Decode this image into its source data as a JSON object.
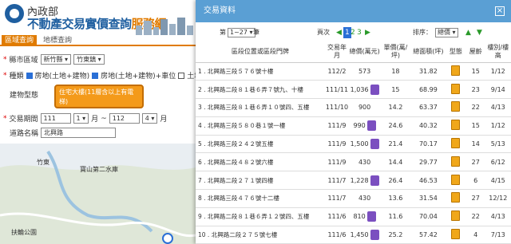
{
  "header": {
    "ministry": "內政部",
    "title_main": "不動產交易實價查詢",
    "title_hl": "服務網"
  },
  "tabs": [
    "區域查詢",
    "地標查詢"
  ],
  "form": {
    "county_label": "縣市區域",
    "county_value": "新竹縣",
    "district_value": "竹東鎮",
    "type_label": "種類",
    "type_options": [
      "房地(土地+建物)",
      "房地(土地+建物)+車位",
      "土地"
    ],
    "building_label": "建物型態",
    "building_value": "住宅大樓(11層含以上有電梯)",
    "period_label": "交易期間",
    "from_year": "111",
    "from_month": "1",
    "to_year": "112",
    "to_month": "4",
    "month_suffix": "月",
    "road_label": "道路名稱",
    "road_value": "北興路",
    "tilde": "~"
  },
  "map": {
    "label_1": "寶山第二水庫",
    "label_2": "扶輪公園",
    "label_3": "竹東"
  },
  "dialog": {
    "title": "交易資料",
    "close": "×",
    "page_prefix": "第",
    "page_sel": "1~27",
    "page_suffix": "筆",
    "page_label": "頁次",
    "pages": [
      "1",
      "2",
      "3"
    ],
    "sort_label": "排序：",
    "sort_value": "總價"
  },
  "columns": [
    "區段位置或區段門牌",
    "交易年月",
    "總價(萬元)",
    "單價(萬/坪)",
    "總面積(坪)",
    "型態",
    "屋齡",
    "樓別/樓高"
  ],
  "rows": [
    {
      "addr": "1 . 北興路三段５７６號十樓",
      "ym": "112/2",
      "total": "573",
      "unit": "18",
      "area": "31.82",
      "age": "15",
      "floor": "1/12",
      "pill": false
    },
    {
      "addr": "2 . 北興路二段８１巷６弄７號九、十樓",
      "ym": "111/11",
      "total": "1,036",
      "unit": "15",
      "area": "68.99",
      "age": "23",
      "floor": "9/14",
      "pill": true
    },
    {
      "addr": "3 . 北興路三段８１巷６弄１０號四、五樓",
      "ym": "111/10",
      "total": "900",
      "unit": "14.2",
      "area": "63.37",
      "age": "22",
      "floor": "4/13",
      "pill": false
    },
    {
      "addr": "4 . 北興路三段５８０巷１號一樓",
      "ym": "111/9",
      "total": "990",
      "unit": "24.6",
      "area": "40.32",
      "age": "15",
      "floor": "1/12",
      "pill": true
    },
    {
      "addr": "5 . 北興路三段２４２號五樓",
      "ym": "111/9",
      "total": "1,500",
      "unit": "21.4",
      "area": "70.17",
      "age": "14",
      "floor": "5/13",
      "pill": true
    },
    {
      "addr": "6 . 北興路二段４８２號六樓",
      "ym": "111/9",
      "total": "430",
      "unit": "14.4",
      "area": "29.77",
      "age": "27",
      "floor": "6/12",
      "pill": false
    },
    {
      "addr": "7 . 北興路二段２７１號四樓",
      "ym": "111/7",
      "total": "1,228",
      "unit": "26.4",
      "area": "46.53",
      "age": "6",
      "floor": "4/15",
      "pill": true
    },
    {
      "addr": "8 . 北興路三段４７６號十二樓",
      "ym": "111/7",
      "total": "430",
      "unit": "13.6",
      "area": "31.54",
      "age": "27",
      "floor": "12/12",
      "pill": false
    },
    {
      "addr": "9 . 北興路二段８１巷６弄１２號四、五樓",
      "ym": "111/6",
      "total": "810",
      "unit": "11.6",
      "area": "70.04",
      "age": "22",
      "floor": "4/13",
      "pill": true
    },
    {
      "addr": "10 . 北興路二段２７５號七樓",
      "ym": "111/6",
      "total": "1,450",
      "unit": "25.2",
      "area": "57.42",
      "age": "4",
      "floor": "7/13",
      "pill": true
    }
  ]
}
